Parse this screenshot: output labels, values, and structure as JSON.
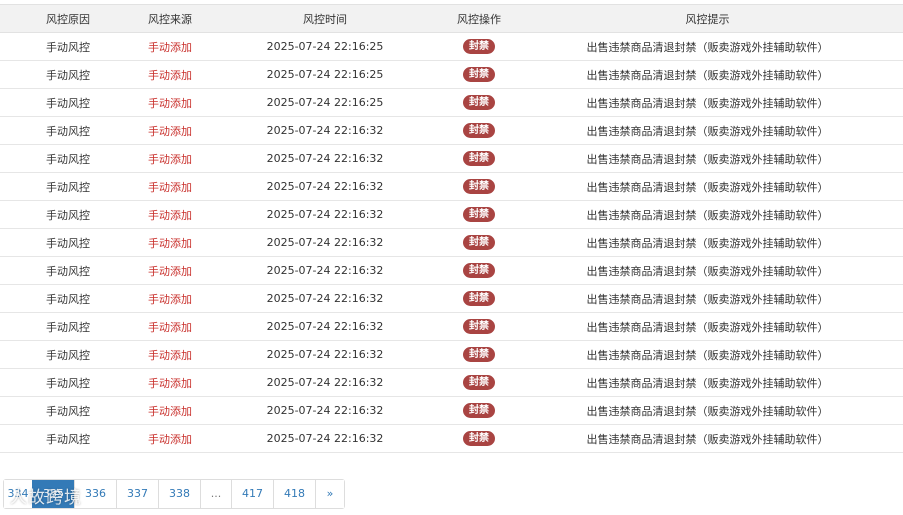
{
  "table": {
    "headers": [
      "风控原因",
      "风控来源",
      "风控时间",
      "风控操作",
      "风控提示"
    ],
    "rows": [
      {
        "reason": "手动风控",
        "source": "手动添加",
        "time": "2025-07-24 22:16:25",
        "action": "封禁",
        "hint": "出售违禁商品清退封禁（贩卖游戏外挂辅助软件）"
      },
      {
        "reason": "手动风控",
        "source": "手动添加",
        "time": "2025-07-24 22:16:25",
        "action": "封禁",
        "hint": "出售违禁商品清退封禁（贩卖游戏外挂辅助软件）"
      },
      {
        "reason": "手动风控",
        "source": "手动添加",
        "time": "2025-07-24 22:16:25",
        "action": "封禁",
        "hint": "出售违禁商品清退封禁（贩卖游戏外挂辅助软件）"
      },
      {
        "reason": "手动风控",
        "source": "手动添加",
        "time": "2025-07-24 22:16:32",
        "action": "封禁",
        "hint": "出售违禁商品清退封禁（贩卖游戏外挂辅助软件）"
      },
      {
        "reason": "手动风控",
        "source": "手动添加",
        "time": "2025-07-24 22:16:32",
        "action": "封禁",
        "hint": "出售违禁商品清退封禁（贩卖游戏外挂辅助软件）"
      },
      {
        "reason": "手动风控",
        "source": "手动添加",
        "time": "2025-07-24 22:16:32",
        "action": "封禁",
        "hint": "出售违禁商品清退封禁（贩卖游戏外挂辅助软件）"
      },
      {
        "reason": "手动风控",
        "source": "手动添加",
        "time": "2025-07-24 22:16:32",
        "action": "封禁",
        "hint": "出售违禁商品清退封禁（贩卖游戏外挂辅助软件）"
      },
      {
        "reason": "手动风控",
        "source": "手动添加",
        "time": "2025-07-24 22:16:32",
        "action": "封禁",
        "hint": "出售违禁商品清退封禁（贩卖游戏外挂辅助软件）"
      },
      {
        "reason": "手动风控",
        "source": "手动添加",
        "time": "2025-07-24 22:16:32",
        "action": "封禁",
        "hint": "出售违禁商品清退封禁（贩卖游戏外挂辅助软件）"
      },
      {
        "reason": "手动风控",
        "source": "手动添加",
        "time": "2025-07-24 22:16:32",
        "action": "封禁",
        "hint": "出售违禁商品清退封禁（贩卖游戏外挂辅助软件）"
      },
      {
        "reason": "手动风控",
        "source": "手动添加",
        "time": "2025-07-24 22:16:32",
        "action": "封禁",
        "hint": "出售违禁商品清退封禁（贩卖游戏外挂辅助软件）"
      },
      {
        "reason": "手动风控",
        "source": "手动添加",
        "time": "2025-07-24 22:16:32",
        "action": "封禁",
        "hint": "出售违禁商品清退封禁（贩卖游戏外挂辅助软件）"
      },
      {
        "reason": "手动风控",
        "source": "手动添加",
        "time": "2025-07-24 22:16:32",
        "action": "封禁",
        "hint": "出售违禁商品清退封禁（贩卖游戏外挂辅助软件）"
      },
      {
        "reason": "手动风控",
        "source": "手动添加",
        "time": "2025-07-24 22:16:32",
        "action": "封禁",
        "hint": "出售违禁商品清退封禁（贩卖游戏外挂辅助软件）"
      },
      {
        "reason": "手动风控",
        "source": "手动添加",
        "time": "2025-07-24 22:16:32",
        "action": "封禁",
        "hint": "出售违禁商品清退封禁（贩卖游戏外挂辅助软件）"
      }
    ]
  },
  "pagination": {
    "pages": [
      "334",
      "335",
      "336",
      "337",
      "338",
      "...",
      "417",
      "418",
      "»"
    ],
    "active": "335"
  },
  "watermark": "人故跨境",
  "colors": {
    "source_text": "#c9302c",
    "badge_bg": "#a94442",
    "pager_active": "#337ab7",
    "header_bg": "#f2f2f2"
  }
}
